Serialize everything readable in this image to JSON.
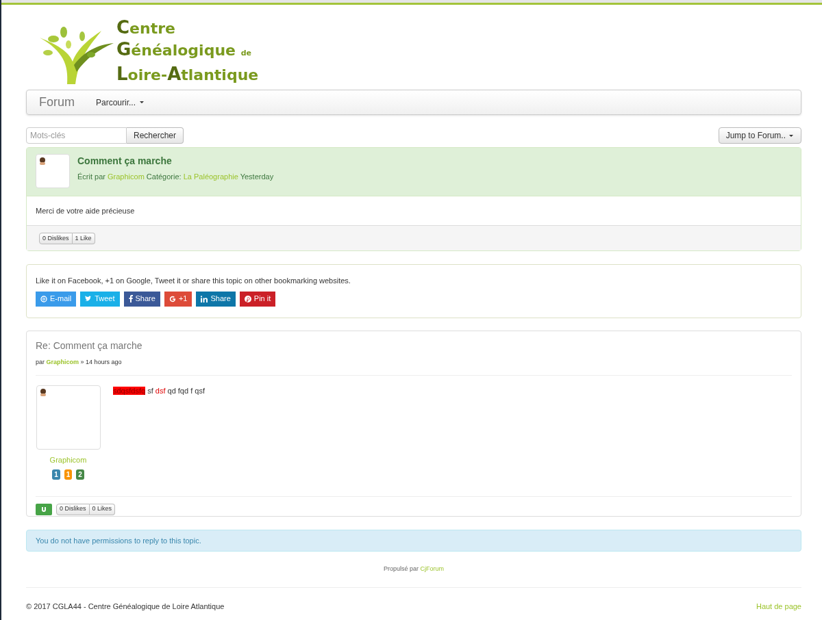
{
  "logo": {
    "lines": [
      "Centre",
      "Généalogique",
      "de",
      "Loire-Atlantique"
    ]
  },
  "navbar": {
    "brand": "Forum",
    "menu": "Parcourir..."
  },
  "search": {
    "placeholder": "Mots-clés",
    "button": "Rechercher"
  },
  "jump_button": "Jump to Forum..",
  "topic": {
    "title": "Comment ça marche",
    "by_label": "Écrit par",
    "author": "Graphicom",
    "category_label": "Catégorie:",
    "category": "La Paléographie",
    "time": "Yesterday",
    "body": "Merci de votre aide précieuse",
    "votes": [
      "0 Dislikes",
      "1 Like"
    ]
  },
  "share": {
    "text": "Like it on Facebook, +1 on Google, Tweet it or share this topic on other bookmarking websites.",
    "buttons": [
      {
        "kind": "email",
        "label": "E-mail",
        "color": "#3a9bea"
      },
      {
        "kind": "twitter",
        "label": "Tweet",
        "color": "#1ab0e8"
      },
      {
        "kind": "facebook",
        "label": "Share",
        "color": "#3b5998"
      },
      {
        "kind": "google",
        "label": "+1",
        "color": "#dd4b39"
      },
      {
        "kind": "linkedin",
        "label": "Share",
        "color": "#0e76a8"
      },
      {
        "kind": "pinterest",
        "label": "Pin it",
        "color": "#cb2027"
      }
    ]
  },
  "reply": {
    "title": "Re: Comment ça marche",
    "by_label": "par",
    "author": "Graphicom",
    "time": "» 14 hours ago",
    "highlight": "sdqsfdsfq",
    "text_1": "sf",
    "red_text": "dsf",
    "text_2": "qd fqd f qsf",
    "user": "Graphicom",
    "badges": [
      {
        "label": "1",
        "color": "#3a87ad"
      },
      {
        "label": "1",
        "color": "#f89406"
      },
      {
        "label": "2",
        "color": "#468847"
      }
    ],
    "votes": [
      "0 Dislikes",
      "0 Likes"
    ]
  },
  "alert": "You do not have permissions to reply to this topic.",
  "powered": {
    "label": "Propulsé par",
    "link": "CjForum"
  },
  "footer": {
    "copyright": "© 2017 CGLA44 - Centre Généalogique de Loire Atlantique",
    "top_link": "Haut de page"
  }
}
